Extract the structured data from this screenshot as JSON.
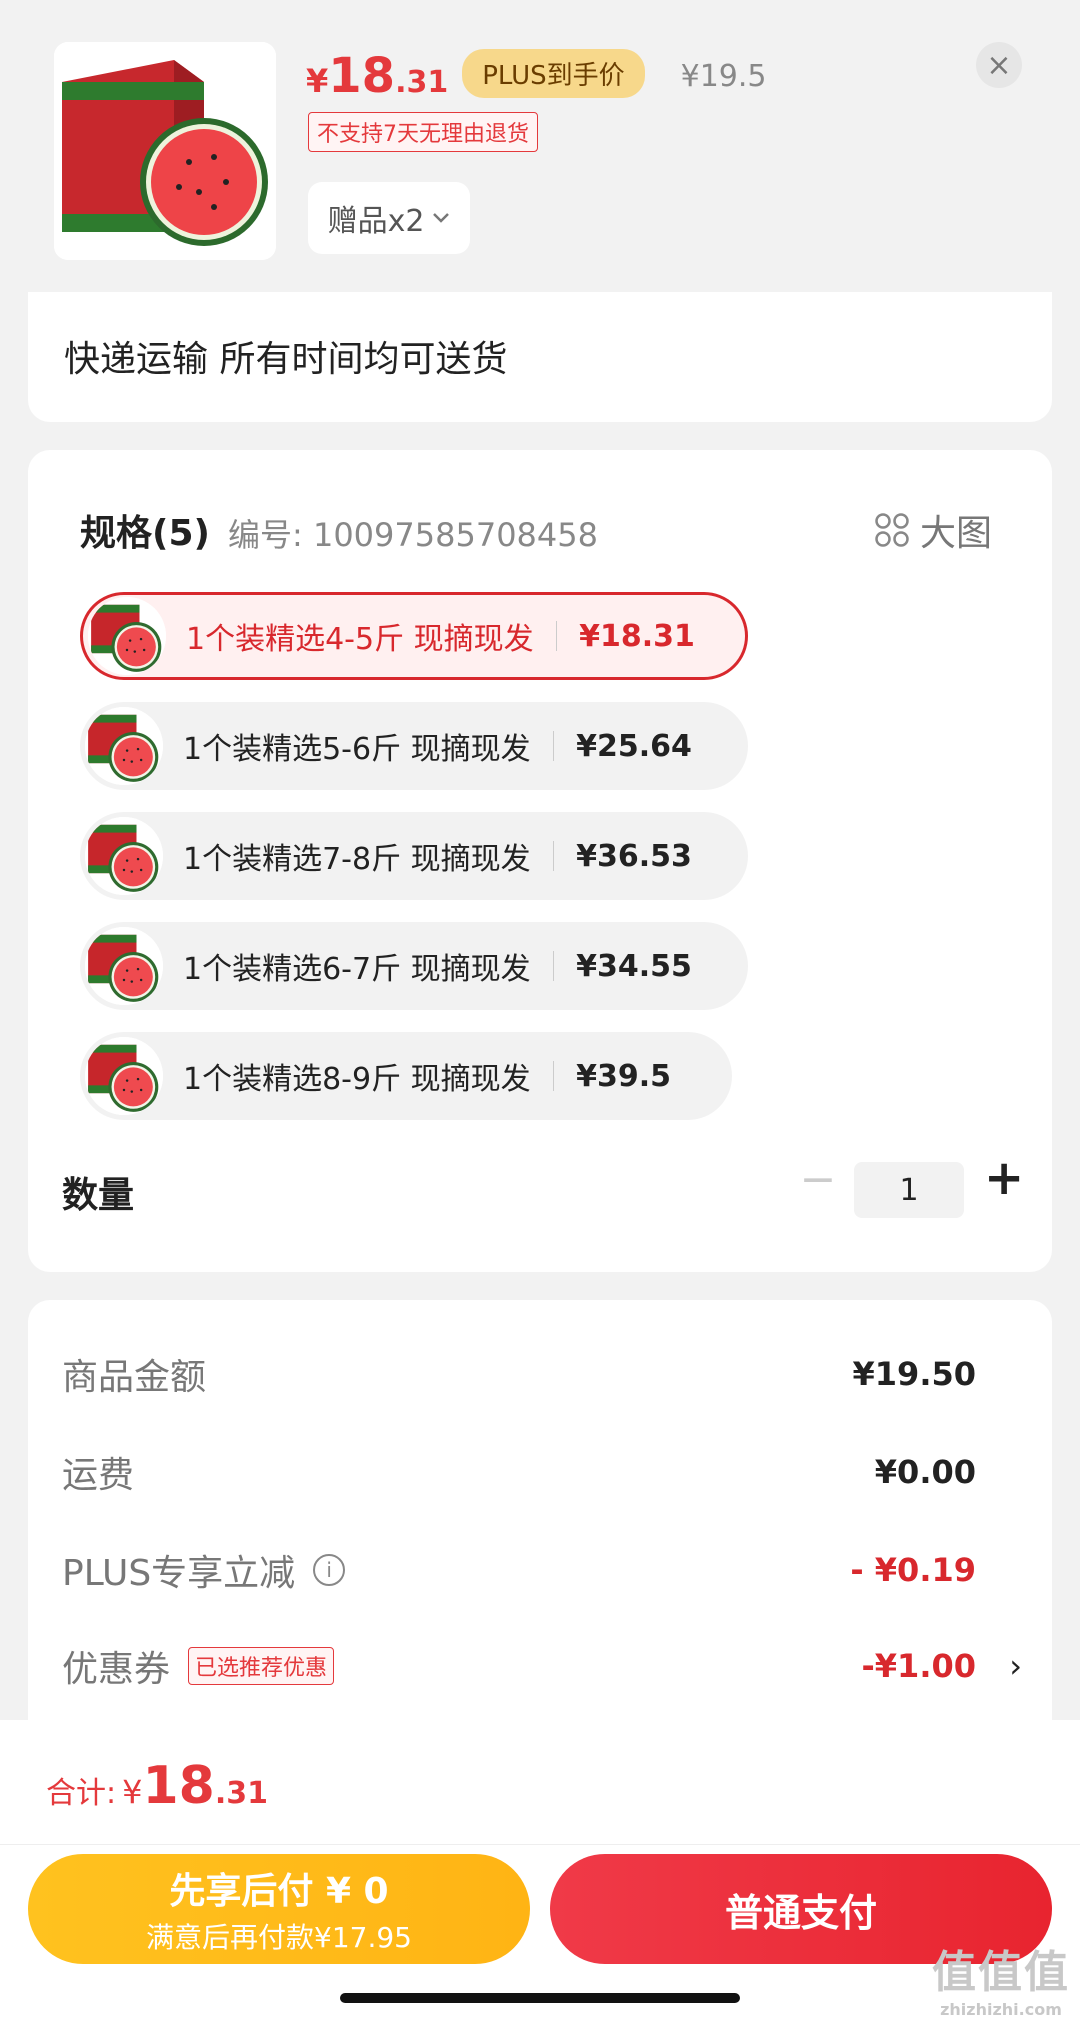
{
  "header": {
    "price": {
      "currency": "¥",
      "integer": "18",
      "decimal": ".31"
    },
    "plus_tag": "PLUS到手价",
    "original_price": "¥19.5",
    "no_return_notice": "不支持7天无理由退货",
    "gift_button": "赠品x2",
    "close": "×"
  },
  "delivery": {
    "text": "快递运输 所有时间均可送货"
  },
  "spec": {
    "title": "规格(5)",
    "code": "编号: 10097585708458",
    "big_pic_label": "大图",
    "options": [
      {
        "label": "1个装精选4-5斤 现摘现发",
        "price": "¥18.31",
        "selected": true
      },
      {
        "label": "1个装精选5-6斤 现摘现发",
        "price": "¥25.64",
        "selected": false
      },
      {
        "label": "1个装精选7-8斤 现摘现发",
        "price": "¥36.53",
        "selected": false
      },
      {
        "label": "1个装精选6-7斤 现摘现发",
        "price": "¥34.55",
        "selected": false
      },
      {
        "label": "1个装精选8-9斤 现摘现发",
        "price": "¥39.5",
        "selected": false
      }
    ]
  },
  "quantity": {
    "label": "数量",
    "minus": "−",
    "value": "1",
    "plus": "+"
  },
  "summary": {
    "goods_amount": {
      "label": "商品金额",
      "value": "¥19.50"
    },
    "shipping": {
      "label": "运费",
      "value": "¥0.00"
    },
    "plus_discount": {
      "label": "PLUS专享立减",
      "value": "- ¥0.19",
      "info_icon": "i"
    },
    "coupon": {
      "label": "优惠券",
      "tag": "已选推荐优惠",
      "value": "-¥1.00",
      "chevron": "›"
    }
  },
  "footer": {
    "total": {
      "label": "合计:",
      "currency": "¥",
      "integer": "18",
      "decimal": ".31"
    },
    "pay_later": {
      "title": "先享后付 ¥ 0",
      "subtitle": "满意后再付款¥17.95"
    },
    "pay_normal": "普通支付",
    "watermark": {
      "line1": "值值值",
      "line2": "zhizhizhi.com"
    }
  },
  "colors": {
    "accent_red": "#e4393c",
    "pay_yellow": "#ffb414",
    "plus_gold": "#f7d88b"
  }
}
